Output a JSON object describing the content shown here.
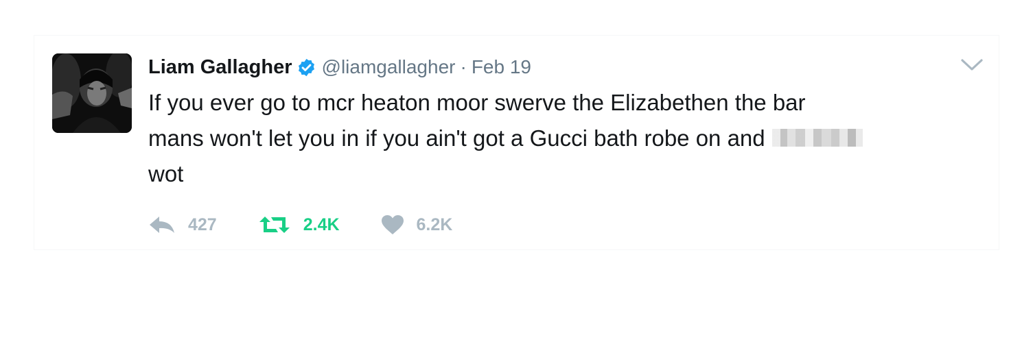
{
  "tweet": {
    "author": {
      "fullname": "Liam Gallagher",
      "handle": "@liamgallagher",
      "verified": true,
      "avatar_icon": "profile-photo"
    },
    "separator": "·",
    "timestamp": "Feb 19",
    "text": {
      "line1": "If you ever go to mcr heaton moor swerve the Elizabethen the bar",
      "line2": "mans won't let you in if you ain't got a Gucci bath robe on and",
      "line3": "wot"
    },
    "actions": {
      "reply": {
        "icon": "reply-icon",
        "count": "427",
        "color": "#aab8c2"
      },
      "retweet": {
        "icon": "retweet-icon",
        "count": "2.4K",
        "color": "#19cf86"
      },
      "like": {
        "icon": "heart-icon",
        "count": "6.2K",
        "color": "#aab8c2"
      }
    },
    "menu_icon": "chevron-down-icon"
  },
  "colors": {
    "text": "#14171a",
    "secondary": "#657786",
    "verified_blue": "#1da1f2",
    "retweet_green": "#19cf86",
    "action_gray": "#aab8c2"
  }
}
